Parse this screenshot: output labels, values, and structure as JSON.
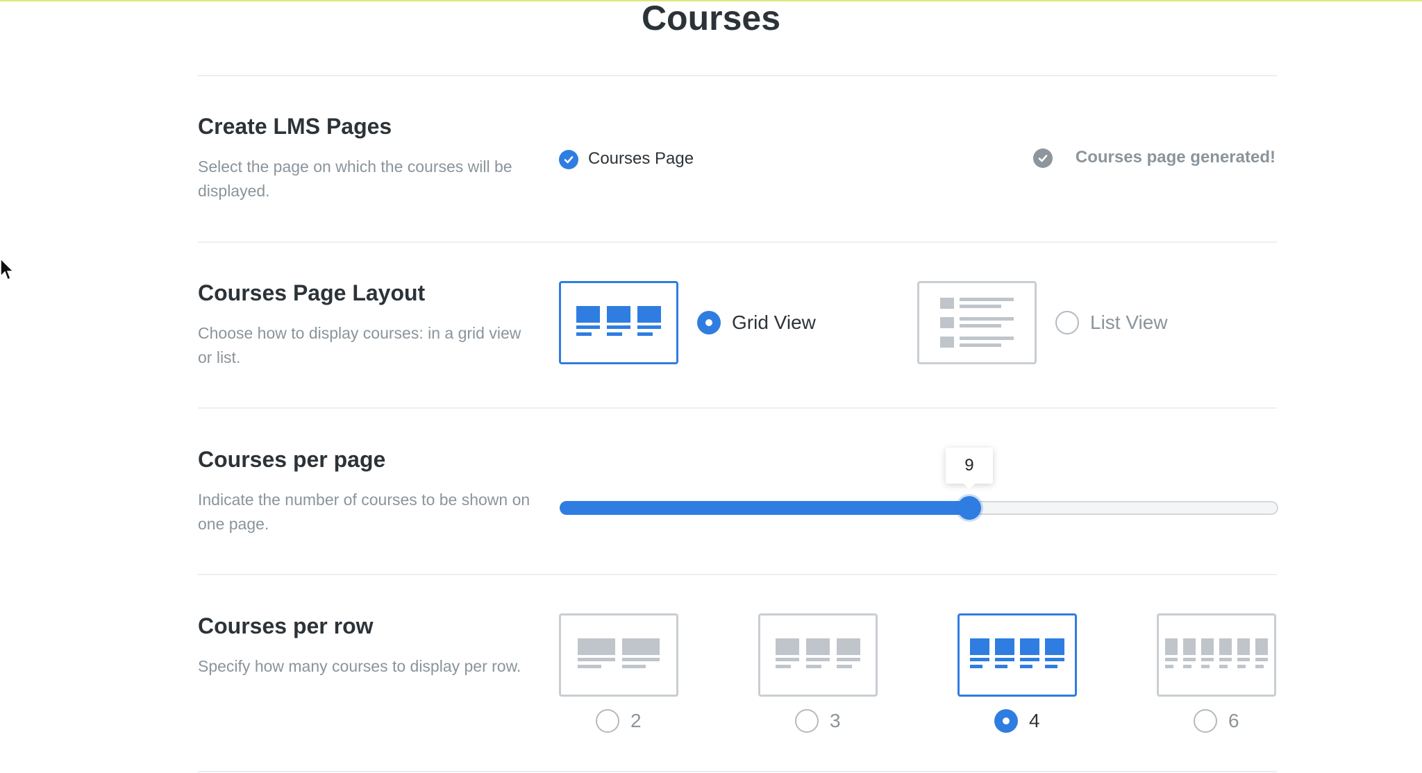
{
  "page": {
    "title": "Courses"
  },
  "colors": {
    "accent": "#2f7de1",
    "muted": "#8a949b",
    "border": "#c8ced2"
  },
  "lms_pages": {
    "title": "Create LMS Pages",
    "description": "Select the page on which the courses will be displayed.",
    "option_label": "Courses Page",
    "status": "Courses page generated!",
    "icons": {
      "option": "check-circle-icon",
      "status": "check-circle-icon"
    }
  },
  "layout": {
    "title": "Courses Page Layout",
    "description": "Choose how to display courses: in a grid view or list.",
    "selected": "grid",
    "options": [
      {
        "id": "grid",
        "label": "Grid View",
        "icon": "grid-layout-icon",
        "selected": true
      },
      {
        "id": "list",
        "label": "List View",
        "icon": "list-layout-icon",
        "selected": false
      }
    ]
  },
  "per_page": {
    "title": "Courses per page",
    "description": "Indicate the number of courses to be shown on one page.",
    "value": 9,
    "fill_fraction": 0.57
  },
  "per_row": {
    "title": "Courses per row",
    "description": "Specify how many courses to display per row.",
    "selected": 4,
    "options": [
      {
        "value": 2,
        "label": "2",
        "selected": false
      },
      {
        "value": 3,
        "label": "3",
        "selected": false
      },
      {
        "value": 4,
        "label": "4",
        "selected": true
      },
      {
        "value": 6,
        "label": "6",
        "selected": false
      }
    ]
  }
}
